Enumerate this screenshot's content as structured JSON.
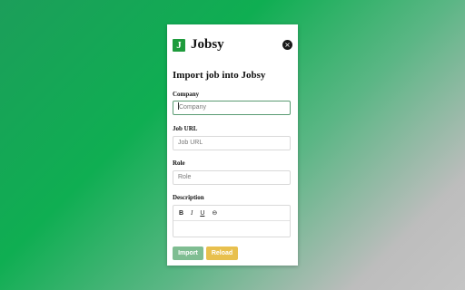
{
  "header": {
    "logo_letter": "J",
    "brand": "Jobsy",
    "close_glyph": "×"
  },
  "form": {
    "title": "Import job into Jobsy",
    "company": {
      "label": "Company",
      "placeholder": "Company",
      "value": ""
    },
    "job_url": {
      "label": "Job URL",
      "placeholder": "Job URL",
      "value": ""
    },
    "role": {
      "label": "Role",
      "placeholder": "Role",
      "value": ""
    },
    "description": {
      "label": "Description",
      "toolbar": {
        "bold": "B",
        "italic": "I",
        "underline": "U",
        "strike": "⊖"
      },
      "value": ""
    }
  },
  "actions": {
    "import_label": "Import",
    "reload_label": "Reload"
  },
  "colors": {
    "brand_green": "#1e9b3c",
    "import_button": "#7fbd92",
    "reload_button": "#e8c04e",
    "focus_border": "#5a9b73"
  }
}
